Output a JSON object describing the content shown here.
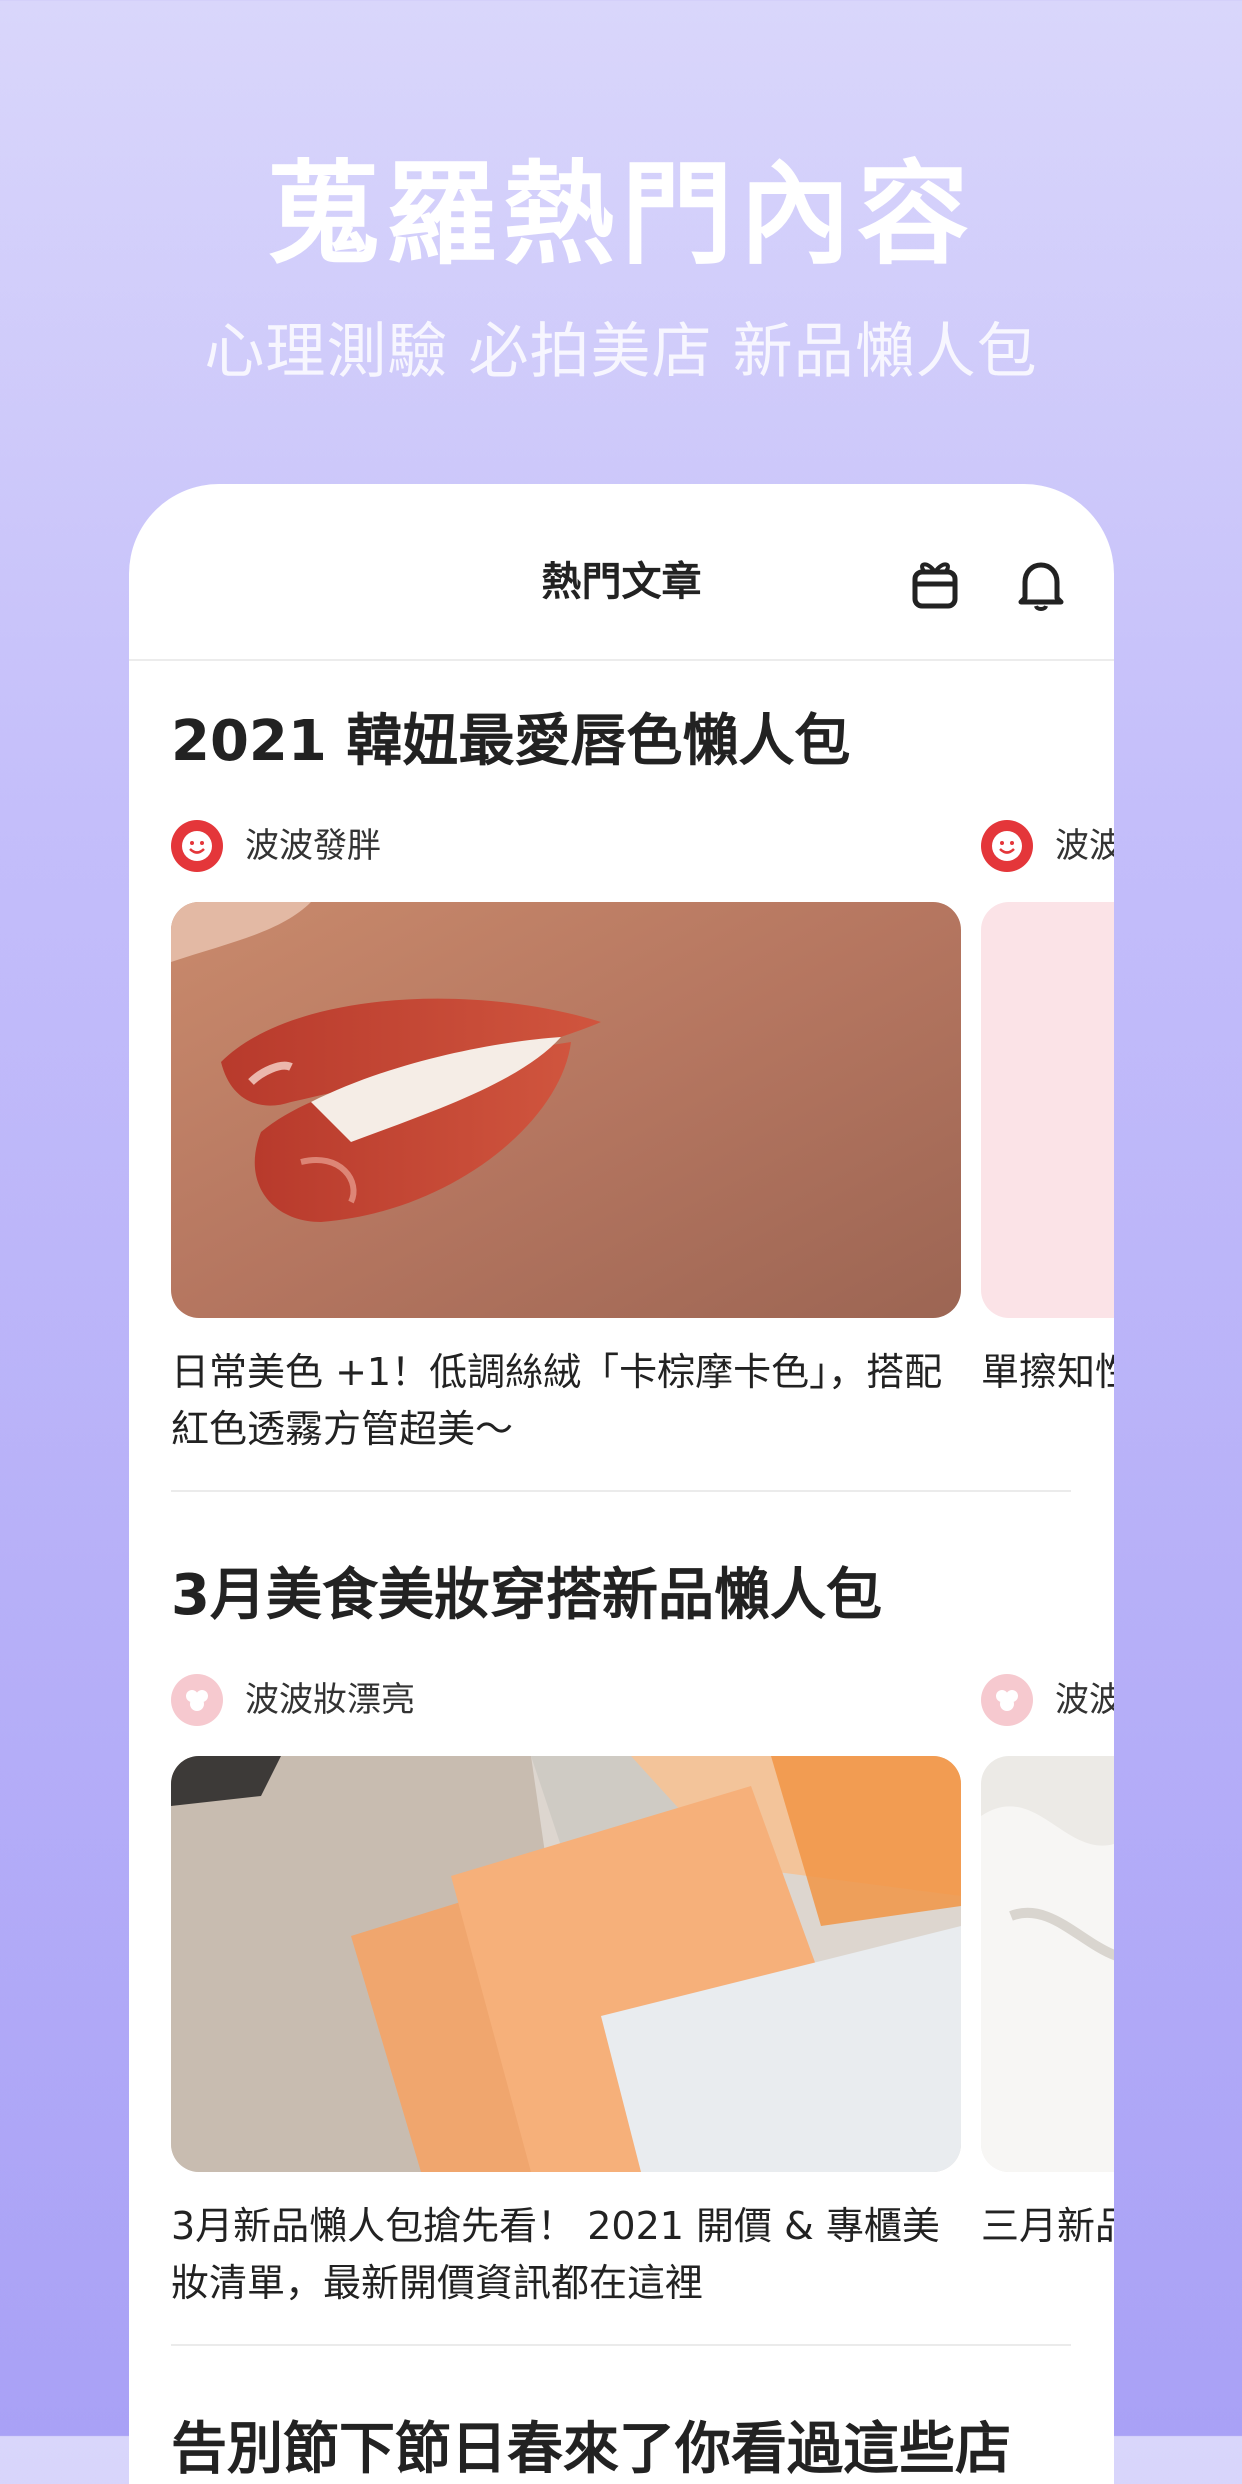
{
  "hero": {
    "title": "蒐羅熱門內容",
    "subtitle": "心理測驗 必拍美店 新品懶人包"
  },
  "nav": {
    "title": "熱門文章",
    "icons": [
      "gift-icon",
      "bell-icon"
    ]
  },
  "sections": [
    {
      "title": "2021 韓妞最愛唇色懶人包",
      "cards": [
        {
          "author": "波波發胖",
          "text": "日常美色 +1！低調絲絨「卡棕摩卡色」，搭配紅色透霧方管超美～"
        },
        {
          "author": "波波",
          "text": "單擦知性裸奶茶色"
        }
      ]
    },
    {
      "title": "3月美食美妝穿搭新品懶人包",
      "cards": [
        {
          "author": "波波妝漂亮",
          "text": "3月新品懶人包搶先看！ 2021 開價 & 專櫃美妝清單，最新開價資訊都在這裡"
        },
        {
          "author": "波波",
          "text": "三月新品在這，"
        }
      ]
    },
    {
      "title": "告別節下節日春來了你看過這些店",
      "cards": []
    }
  ],
  "colors": {
    "accent_red": "#e4363a",
    "avatar_pink": "#f6c9cf",
    "background_top": "#d9d6fb",
    "background_bottom": "#a9a1f6"
  }
}
